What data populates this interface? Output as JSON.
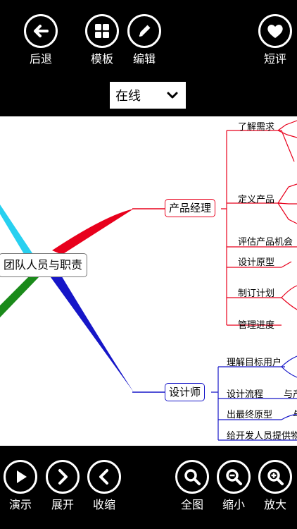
{
  "toolbar_top": {
    "back": "后退",
    "template": "模板",
    "edit": "编辑",
    "review": "短评"
  },
  "mode_select": {
    "value": "在线"
  },
  "mindmap": {
    "root": "团队人员与职责",
    "branches": [
      {
        "label": "产品经理",
        "color": "#e8001c",
        "children": [
          "了解需求",
          "定义产品",
          "评估产品机会",
          "设计原型",
          "制订计划",
          "管理进度"
        ]
      },
      {
        "label": "设计师",
        "color": "#1616c8",
        "children": [
          "理解目标用户",
          "设计流程",
          "出最终原型",
          "给开发人员提供物"
        ],
        "side_labels": [
          "与产",
          "与"
        ]
      }
    ]
  },
  "toolbar_bottom": {
    "present": "演示",
    "expand": "展开",
    "collapse": "收缩",
    "fit": "全图",
    "zoom_out": "缩小",
    "zoom_in": "放大"
  }
}
